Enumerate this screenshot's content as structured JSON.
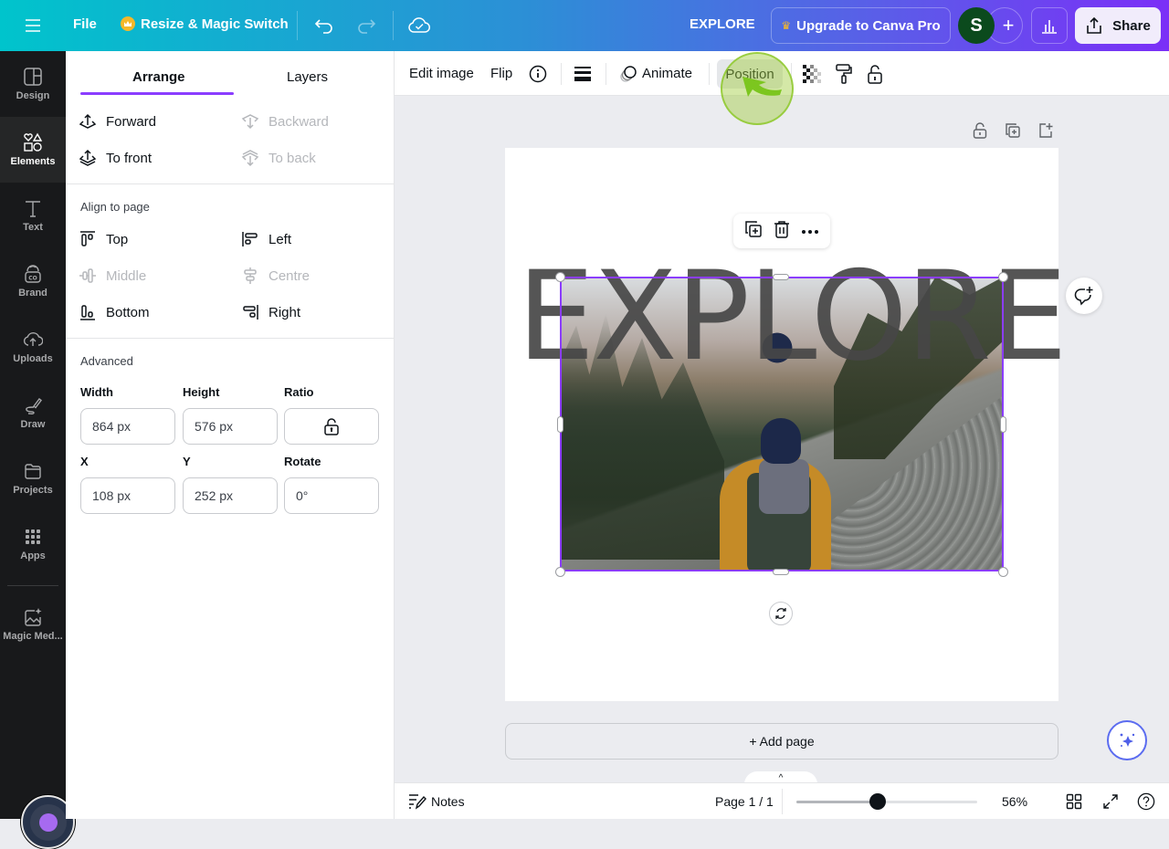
{
  "topbar": {
    "file_label": "File",
    "resize_label": "Resize & Magic Switch",
    "doc_title": "EXPLORE",
    "upgrade_label": "Upgrade to Canva Pro",
    "avatar_initial": "S",
    "share_label": "Share"
  },
  "rail": {
    "items": [
      {
        "label": "Design",
        "icon": "layout-icon"
      },
      {
        "label": "Elements",
        "icon": "shapes-icon",
        "active": true
      },
      {
        "label": "Text",
        "icon": "text-icon"
      },
      {
        "label": "Brand",
        "icon": "brand-icon"
      },
      {
        "label": "Uploads",
        "icon": "cloud-upload-icon"
      },
      {
        "label": "Draw",
        "icon": "pen-icon"
      },
      {
        "label": "Projects",
        "icon": "folder-icon"
      },
      {
        "label": "Apps",
        "icon": "grid-icon"
      },
      {
        "label": "Magic Med...",
        "icon": "magic-media-icon"
      }
    ]
  },
  "panel": {
    "tabs": [
      {
        "label": "Arrange",
        "active": true
      },
      {
        "label": "Layers"
      }
    ],
    "order": [
      {
        "label": "Forward",
        "enabled": true
      },
      {
        "label": "Backward",
        "enabled": false
      },
      {
        "label": "To front",
        "enabled": true
      },
      {
        "label": "To back",
        "enabled": false
      }
    ],
    "align_heading": "Align to page",
    "align": [
      {
        "label": "Top",
        "enabled": true
      },
      {
        "label": "Left",
        "enabled": true
      },
      {
        "label": "Middle",
        "enabled": false
      },
      {
        "label": "Centre",
        "enabled": false
      },
      {
        "label": "Bottom",
        "enabled": true
      },
      {
        "label": "Right",
        "enabled": true
      }
    ],
    "advanced_heading": "Advanced",
    "fields": {
      "width_label": "Width",
      "width_value": "864 px",
      "height_label": "Height",
      "height_value": "576 px",
      "ratio_label": "Ratio",
      "x_label": "X",
      "x_value": "108 px",
      "y_label": "Y",
      "y_value": "252 px",
      "rotate_label": "Rotate",
      "rotate_value": "0°"
    }
  },
  "context_toolbar": {
    "edit_image": "Edit image",
    "flip": "Flip",
    "animate": "Animate",
    "position": "Position"
  },
  "canvas": {
    "heading_text": "EXPLORE",
    "add_page_label": "+ Add page"
  },
  "footer": {
    "notes_label": "Notes",
    "page_indicator": "Page 1 / 1",
    "zoom_percent": 56,
    "zoom_label": "56%",
    "zoom_slider_fraction": 0.45,
    "collapse_glyph": "^"
  },
  "colors": {
    "accent": "#8b3dff",
    "rail_bg": "#18191b",
    "avatar_bg": "#0b4a1d"
  }
}
